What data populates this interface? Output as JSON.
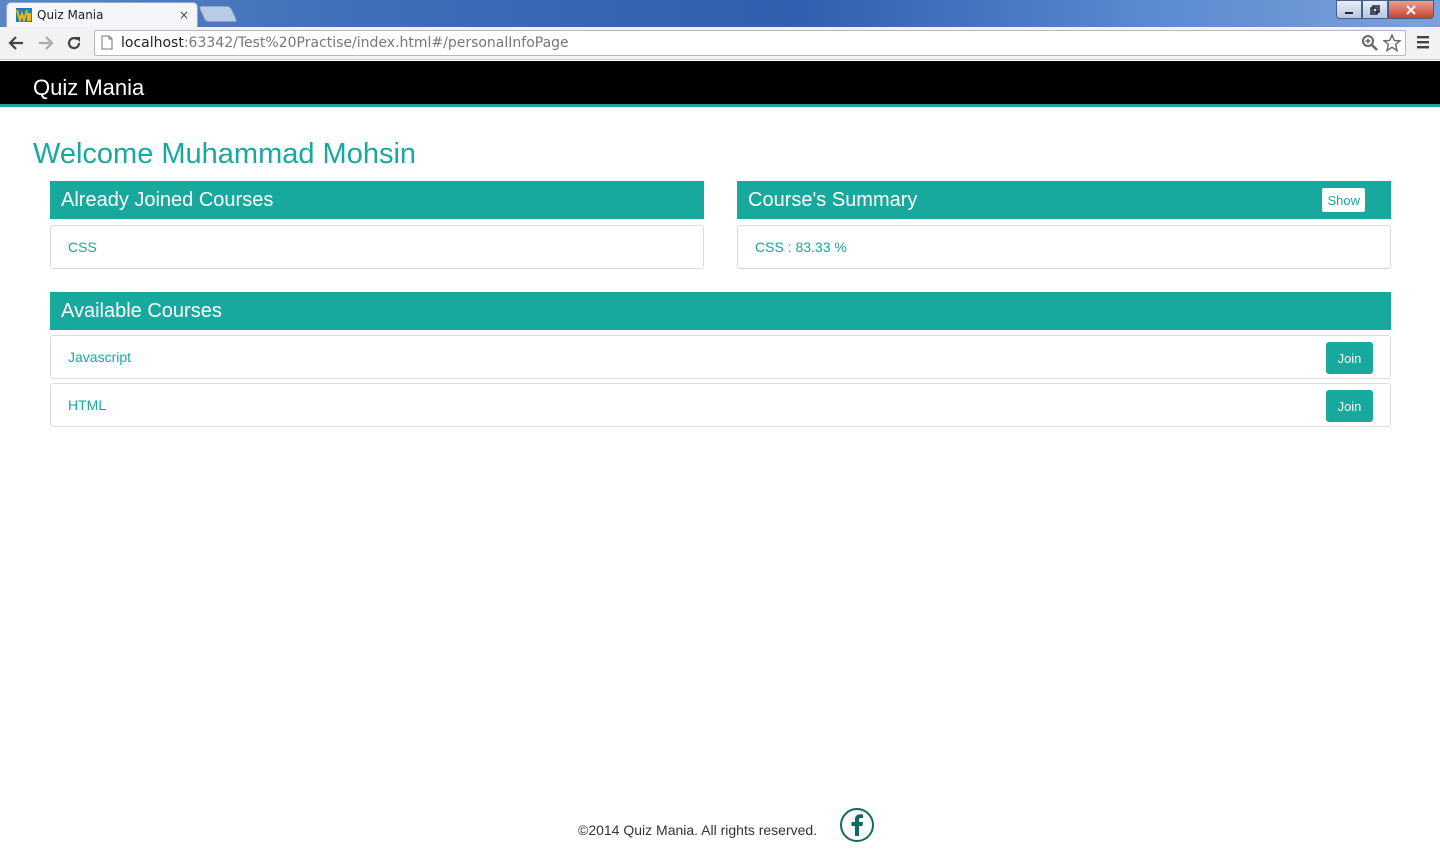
{
  "browser": {
    "tab_title": "Quiz Mania",
    "tab_close": "×",
    "url_host": "localhost",
    "url_rest": ":63342/Test%20Practise/index.html#/personalInfoPage"
  },
  "navbar": {
    "brand": "Quiz Mania"
  },
  "page": {
    "welcome": "Welcome Muhammad Mohsin"
  },
  "joined_panel": {
    "title": "Already Joined Courses",
    "items": [
      {
        "label": "CSS"
      }
    ]
  },
  "summary_panel": {
    "title": "Course's Summary",
    "show_label": "Show",
    "items": [
      {
        "label": "CSS : 83.33 %"
      }
    ]
  },
  "available_panel": {
    "title": "Available Courses",
    "items": [
      {
        "label": "Javascript",
        "button": "Join"
      },
      {
        "label": "HTML",
        "button": "Join"
      }
    ]
  },
  "footer": {
    "text": "©2014 Quiz Mania. All rights reserved."
  },
  "theme": {
    "accent": "#17a89e",
    "navbar": "#000000"
  }
}
